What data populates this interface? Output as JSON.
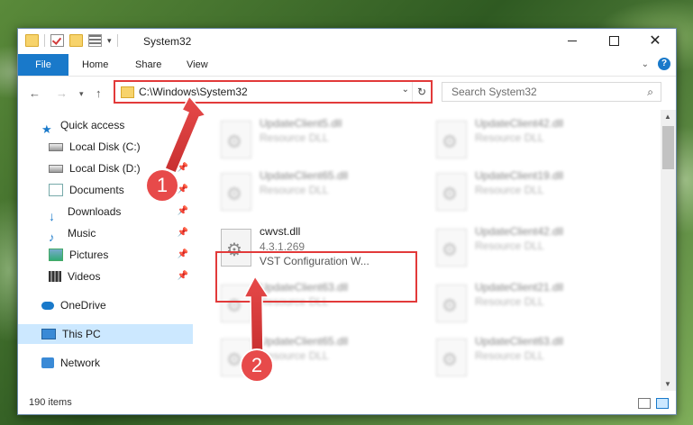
{
  "window": {
    "title": "System32"
  },
  "ribbon": {
    "tabs": [
      "File",
      "Home",
      "Share",
      "View"
    ]
  },
  "address": {
    "path": "C:\\Windows\\System32",
    "refresh_icon": "↻"
  },
  "search": {
    "placeholder": "Search System32"
  },
  "nav": {
    "items": [
      {
        "label": "Quick access"
      },
      {
        "label": "Local Disk (C:)"
      },
      {
        "label": "Local Disk (D:)"
      },
      {
        "label": "Documents"
      },
      {
        "label": "Downloads"
      },
      {
        "label": "Music"
      },
      {
        "label": "Pictures"
      },
      {
        "label": "Videos"
      },
      {
        "label": "OneDrive"
      },
      {
        "label": "This PC"
      },
      {
        "label": "Network"
      }
    ]
  },
  "files": [
    {
      "name": "UpdateClient5.dll",
      "desc": "Resource DLL"
    },
    {
      "name": "UpdateClient42.dll",
      "desc": "Resource DLL"
    },
    {
      "name": "UpdateClient65.dll",
      "desc": "Resource DLL"
    },
    {
      "name": "UpdateClient19.dll",
      "desc": "Resource DLL"
    },
    {
      "name": "cwvst.dll",
      "version": "4.3.1.269",
      "desc": "VST Configuration W..."
    },
    {
      "name": "UpdateClient42.dll",
      "desc": "Resource DLL"
    },
    {
      "name": "UpdateClient63.dll",
      "desc": "Resource DLL"
    },
    {
      "name": "UpdateClient21.dll",
      "desc": "Resource DLL"
    },
    {
      "name": "UpdateClient65.dll",
      "desc": "Resource DLL"
    },
    {
      "name": "UpdateClient63.dll",
      "desc": "Resource DLL"
    }
  ],
  "status": {
    "count": "190 items"
  },
  "annotations": {
    "badge1": "1",
    "badge2": "2"
  },
  "colors": {
    "accent": "#1979ca",
    "highlight": "#e23a3a",
    "selection": "#cce8ff"
  }
}
